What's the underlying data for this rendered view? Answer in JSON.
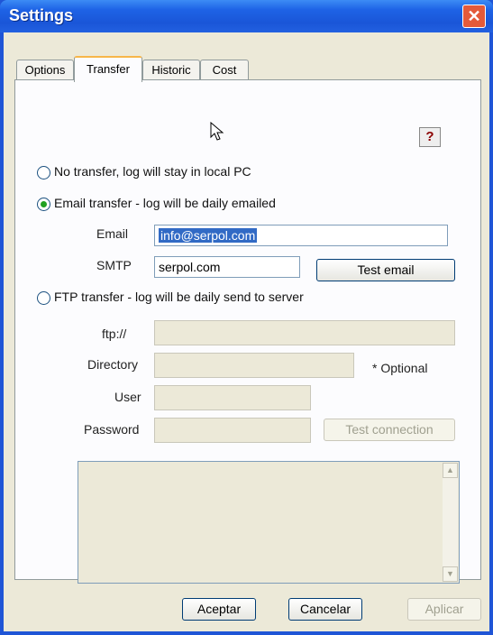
{
  "window": {
    "title": "Settings"
  },
  "tabs": [
    {
      "label": "Options"
    },
    {
      "label": "Transfer"
    },
    {
      "label": "Historic"
    },
    {
      "label": "Cost"
    }
  ],
  "transfer": {
    "options": [
      {
        "label": "No transfer, log will stay in local PC",
        "checked": false
      },
      {
        "label": "Email transfer - log will be daily emailed",
        "checked": true
      },
      {
        "label": "FTP transfer - log will be daily send to server",
        "checked": false
      }
    ],
    "email": {
      "label": "Email",
      "value": "info@serpol.com"
    },
    "smtp": {
      "label": "SMTP",
      "value": "serpol.com"
    },
    "test_email_label": "Test email",
    "ftp": {
      "ftp_label": "ftp://",
      "directory_label": "Directory",
      "optional_note": "* Optional",
      "user_label": "User",
      "password_label": "Password",
      "test_connection_label": "Test connection"
    }
  },
  "footer": {
    "accept": "Aceptar",
    "cancel": "Cancelar",
    "apply": "Aplicar"
  },
  "icons": {
    "help": "help-icon",
    "close": "close-icon",
    "scroll_up": "scroll-up-arrow-icon",
    "scroll_down": "scroll-down-arrow-icon",
    "cursor": "mouse-cursor-icon"
  },
  "colors": {
    "titlebar": "#1f55d6",
    "active_tab": "#f7b64a",
    "selection": "#316ac5"
  }
}
